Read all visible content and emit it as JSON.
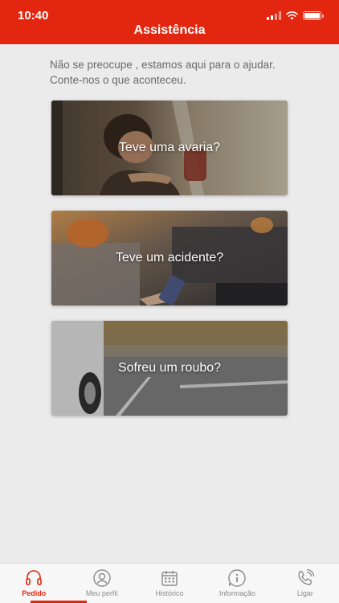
{
  "status_bar": {
    "time": "10:40"
  },
  "header": {
    "title": "Assistência"
  },
  "intro": {
    "line1": "Não se preocupe , estamos aqui para o ajudar.",
    "line2": "Conte-nos o que aconteceu."
  },
  "cards": [
    {
      "label": "Teve uma avaria?"
    },
    {
      "label": "Teve um acidente?"
    },
    {
      "label": "Sofreu um roubo?"
    }
  ],
  "tabbar": {
    "active": "Pedido",
    "items": [
      {
        "label": "Pedido",
        "icon": "headset-icon"
      },
      {
        "label": "Meu perfil",
        "icon": "user-icon"
      },
      {
        "label": "Histórico",
        "icon": "calendar-icon"
      },
      {
        "label": "Informação",
        "icon": "info-icon"
      },
      {
        "label": "Ligar",
        "icon": "phone-icon"
      }
    ]
  },
  "colors": {
    "brand": "#e3260f",
    "background": "#ebebeb",
    "tab_inactive": "#8a8a8a"
  }
}
